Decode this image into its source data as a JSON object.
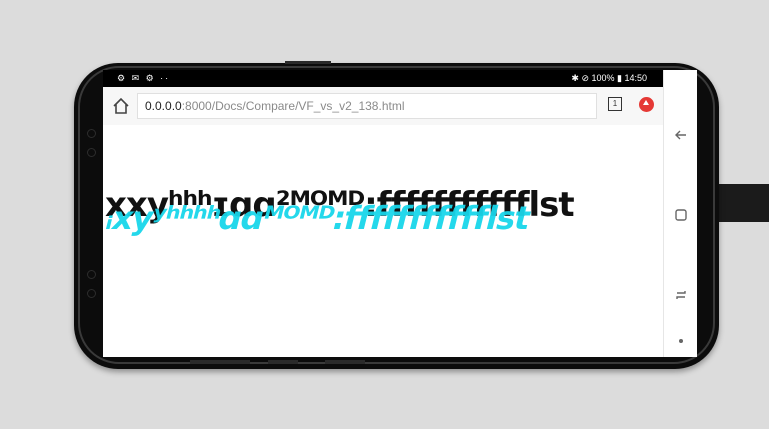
{
  "statusbar": {
    "left_icons": "⚙ ✉ ⚙  ··",
    "right_text": "✱ ⊘ 100% ▮ 14:50"
  },
  "browser": {
    "url_host": "0.0.0.0",
    "url_path": ":8000/Docs/Compare/VF_vs_v2_138.html",
    "tab_count": "1"
  },
  "content": {
    "line_black": "xxyʰʰʰɪɑɑ²ᴹᴼᴹᴰ:ffffffffffflst",
    "line_cyan": "ᵢxyʸʰʰʰʰɑɑᴹᴼᴹᴰ:ffffffffffflst"
  },
  "colors": {
    "overlay": "#19d6ea",
    "ext_button": "#e53935"
  }
}
